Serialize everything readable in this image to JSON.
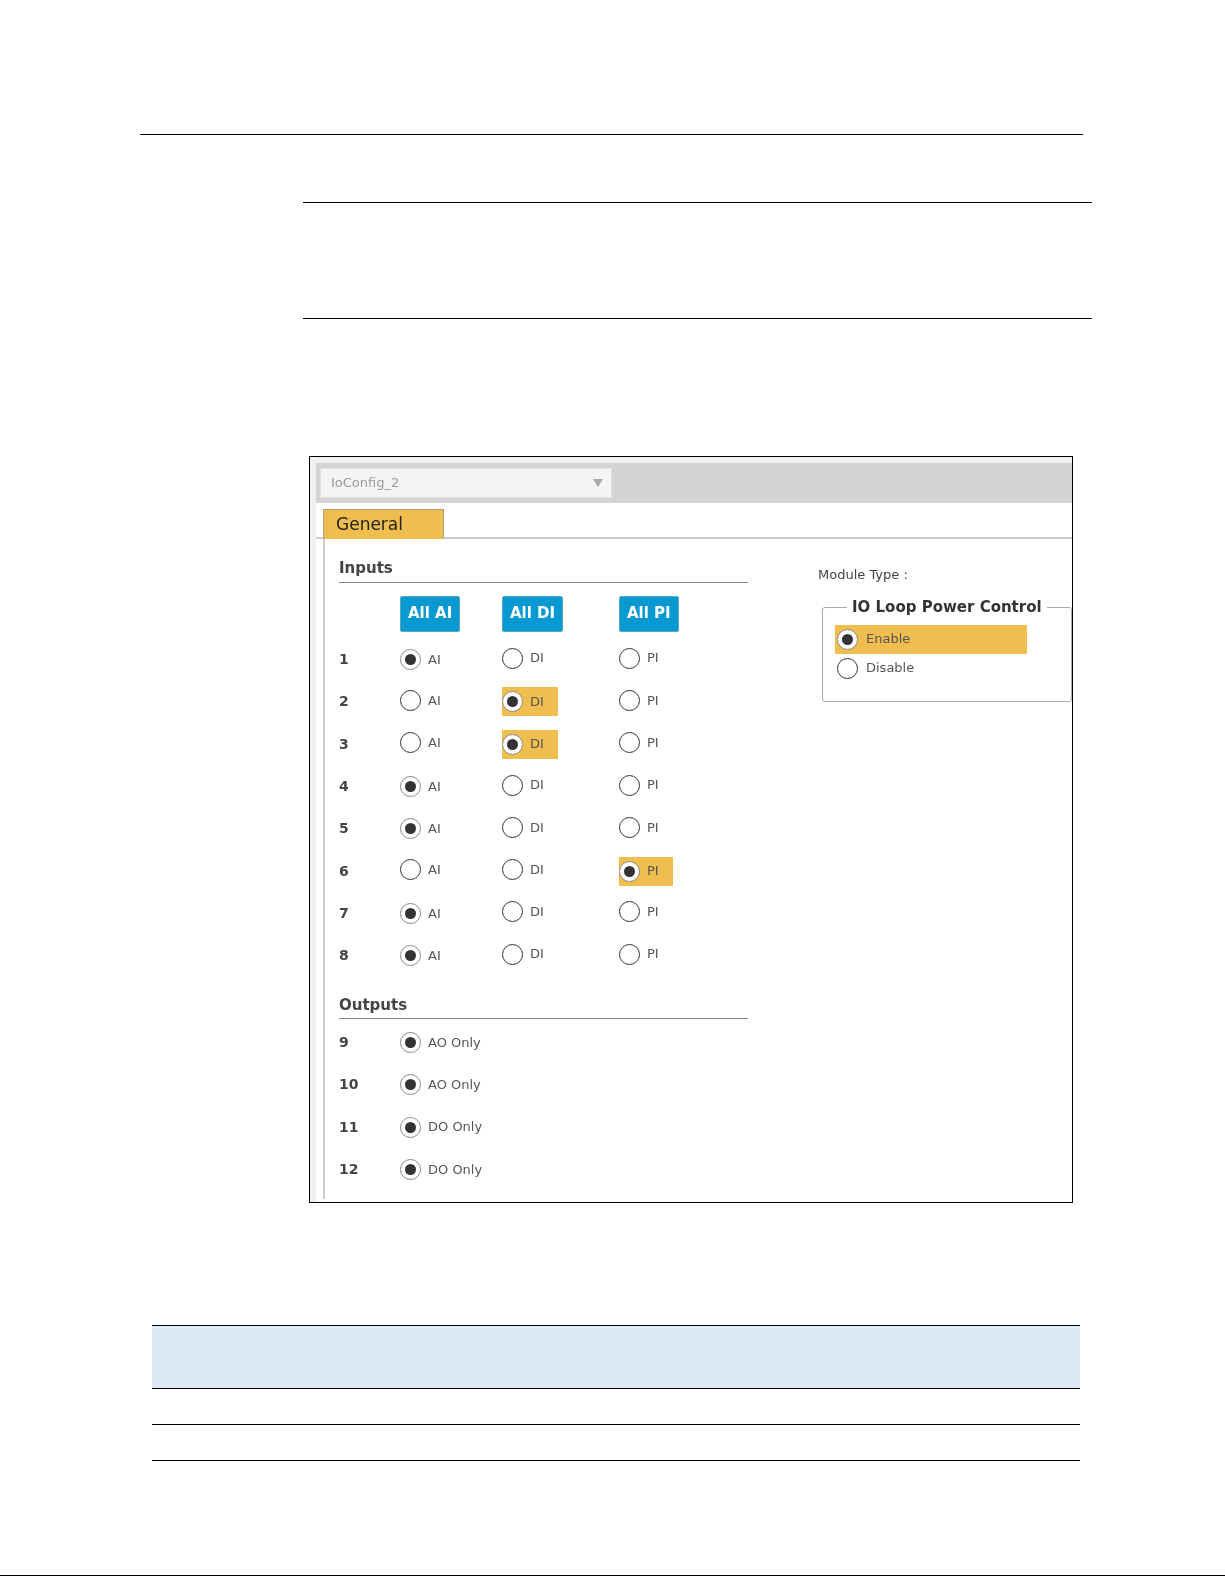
{
  "dropdown": {
    "value": "IoConfig_2"
  },
  "tabs": [
    {
      "label": "General",
      "selected": true
    }
  ],
  "inputs": {
    "title": "Inputs",
    "buttons": [
      "All AI",
      "All DI",
      "All PI"
    ],
    "rows": [
      {
        "number": "1",
        "options": [
          {
            "label": "AI",
            "selected": true,
            "highlighted": false
          },
          {
            "label": "DI",
            "selected": false,
            "highlighted": false
          },
          {
            "label": "PI",
            "selected": false,
            "highlighted": false
          }
        ]
      },
      {
        "number": "2",
        "options": [
          {
            "label": "AI",
            "selected": false,
            "highlighted": false
          },
          {
            "label": "DI",
            "selected": true,
            "highlighted": true
          },
          {
            "label": "PI",
            "selected": false,
            "highlighted": false
          }
        ]
      },
      {
        "number": "3",
        "options": [
          {
            "label": "AI",
            "selected": false,
            "highlighted": false
          },
          {
            "label": "DI",
            "selected": true,
            "highlighted": true
          },
          {
            "label": "PI",
            "selected": false,
            "highlighted": false
          }
        ]
      },
      {
        "number": "4",
        "options": [
          {
            "label": "AI",
            "selected": true,
            "highlighted": false
          },
          {
            "label": "DI",
            "selected": false,
            "highlighted": false
          },
          {
            "label": "PI",
            "selected": false,
            "highlighted": false
          }
        ]
      },
      {
        "number": "5",
        "options": [
          {
            "label": "AI",
            "selected": true,
            "highlighted": false
          },
          {
            "label": "DI",
            "selected": false,
            "highlighted": false
          },
          {
            "label": "PI",
            "selected": false,
            "highlighted": false
          }
        ]
      },
      {
        "number": "6",
        "options": [
          {
            "label": "AI",
            "selected": false,
            "highlighted": false
          },
          {
            "label": "DI",
            "selected": false,
            "highlighted": false
          },
          {
            "label": "PI",
            "selected": true,
            "highlighted": true
          }
        ]
      },
      {
        "number": "7",
        "options": [
          {
            "label": "AI",
            "selected": true,
            "highlighted": false
          },
          {
            "label": "DI",
            "selected": false,
            "highlighted": false
          },
          {
            "label": "PI",
            "selected": false,
            "highlighted": false
          }
        ]
      },
      {
        "number": "8",
        "options": [
          {
            "label": "AI",
            "selected": true,
            "highlighted": false
          },
          {
            "label": "DI",
            "selected": false,
            "highlighted": false
          },
          {
            "label": "PI",
            "selected": false,
            "highlighted": false
          }
        ]
      }
    ]
  },
  "outputs": {
    "title": "Outputs",
    "rows": [
      {
        "number": "9",
        "option": {
          "label": "AO Only",
          "selected": true
        }
      },
      {
        "number": "10",
        "option": {
          "label": "AO Only",
          "selected": true
        }
      },
      {
        "number": "11",
        "option": {
          "label": "DO Only",
          "selected": true
        }
      },
      {
        "number": "12",
        "option": {
          "label": "DO Only",
          "selected": true
        }
      }
    ]
  },
  "module_type": {
    "label": "Module Type :"
  },
  "power_control": {
    "title": "IO Loop Power Control",
    "options": [
      {
        "label": "Enable",
        "selected": true,
        "highlighted": true
      },
      {
        "label": "Disable",
        "selected": false,
        "highlighted": false
      }
    ]
  }
}
